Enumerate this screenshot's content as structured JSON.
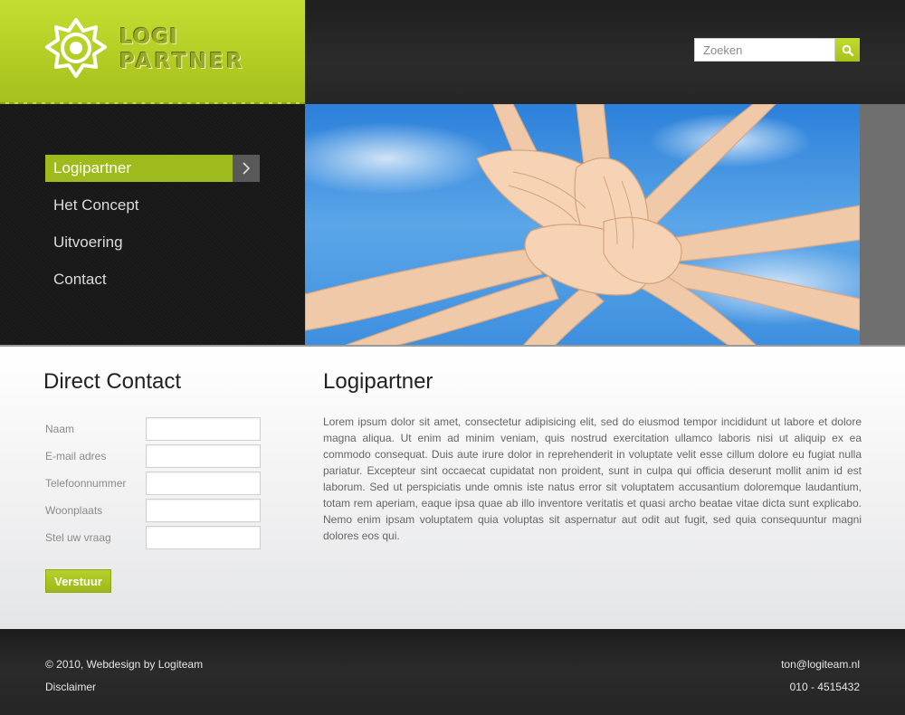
{
  "colors": {
    "brand_green": "#b2cc23",
    "dark_bg": "#262626",
    "nav_bg": "#181818",
    "sky_blue": "#4a9ae4"
  },
  "header": {
    "logo": {
      "line1": "LOGI",
      "line2": "PARTNER",
      "icon": "logo-sun-icon"
    },
    "search": {
      "placeholder": "Zoeken",
      "value": "",
      "icon": "search-icon"
    }
  },
  "nav": {
    "items": [
      {
        "label": "Logipartner",
        "active": true
      },
      {
        "label": "Het Concept",
        "active": false
      },
      {
        "label": "Uitvoering",
        "active": false
      },
      {
        "label": "Contact",
        "active": false
      }
    ]
  },
  "contact": {
    "title": "Direct Contact",
    "fields": [
      {
        "label": "Naam",
        "value": ""
      },
      {
        "label": "E-mail adres",
        "value": ""
      },
      {
        "label": "Telefoonnummer",
        "value": ""
      },
      {
        "label": "Woonplaats",
        "value": ""
      },
      {
        "label": "Stel uw vraag",
        "value": ""
      }
    ],
    "submit_label": "Verstuur"
  },
  "article": {
    "title": "Logipartner",
    "body": "Lorem ipsum dolor sit amet, consectetur adipisicing elit, sed do eiusmod tempor incididunt ut labore et dolore magna aliqua. Ut enim ad minim veniam, quis nostrud exercitation ullamco laboris nisi ut aliquip ex ea commodo consequat. Duis aute irure dolor in reprehenderit in voluptate velit esse cillum dolore eu fugiat nulla pariatur. Excepteur sint occaecat cupidatat non proident, sunt in culpa qui officia deserunt mollit anim id est laborum. Sed ut perspiciatis unde omnis iste natus error sit voluptatem accusantium doloremque laudantium, totam rem aperiam, eaque ipsa quae ab illo inventore veritatis et quasi archo beatae vitae dicta sunt explicabo. Nemo enim ipsam voluptatem quia voluptas sit aspernatur aut odit aut fugit, sed quia consequuntur magni dolores eos qui."
  },
  "footer": {
    "copyright": "© 2010, Webdesign by Logiteam",
    "disclaimer": "Disclaimer",
    "email": "ton@logiteam.nl",
    "phone": "010 - 4515432"
  }
}
